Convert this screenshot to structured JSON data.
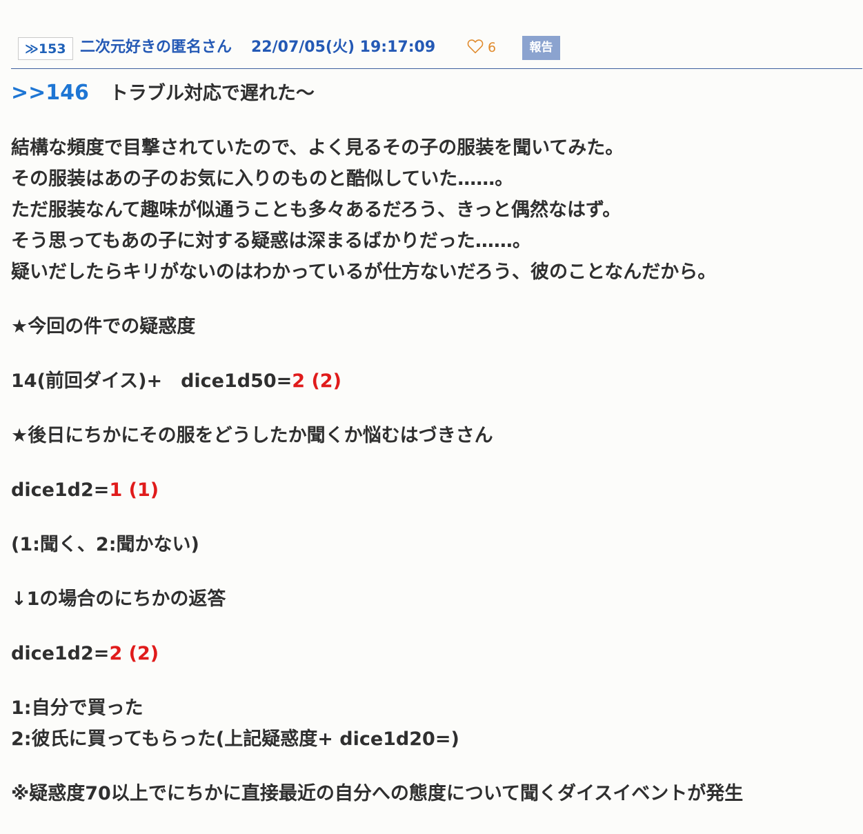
{
  "header": {
    "res_number": "≫153",
    "author": "二次元好きの匿名さん",
    "timestamp": "22/07/05(火) 19:17:09",
    "like_count": "6",
    "report_label": "報告",
    "colors": {
      "author": "#2459b5",
      "like": "#e08a2c",
      "report_bg": "#8ba3cf",
      "divider": "#3d5e9e"
    }
  },
  "body": {
    "anchor": ">>146",
    "anchor_text": "トラブル対応で遅れた〜",
    "para1": [
      "結構な頻度で目撃されていたので、よく見るその子の服装を聞いてみた。",
      "その服装はあの子のお気に入りのものと酷似していた……。",
      "ただ服装なんて趣味が似通うことも多々あるだろう、きっと偶然なはず。",
      "そう思ってもあの子に対する疑惑は深まるばかりだった……。",
      "疑いだしたらキリがないのはわかっているが仕方ないだろう、彼のことなんだから。"
    ],
    "section1_title": "★今回の件での疑惑度",
    "dice1_prefix": "14(前回ダイス)+　dice1d50=",
    "dice1_result": "2 (2)",
    "section2_title": "★後日にちかにその服をどうしたか聞くか悩むはづきさん",
    "dice2_prefix": "dice1d2=",
    "dice2_result": "1 (1)",
    "options1": "(1:聞く、2:聞かない)",
    "section3_title": "↓1の場合のにちかの返答",
    "dice3_prefix": "dice1d2=",
    "dice3_result": "2 (2)",
    "options2": [
      "1:自分で買った",
      "2:彼氏に買ってもらった(上記疑惑度+ dice1d20=)"
    ],
    "note": "※疑惑度70以上でにちかに直接最近の自分への態度について聞くダイスイベントが発生",
    "colors": {
      "text": "#2f2f2f",
      "anchor": "#1e76d4",
      "dice_result": "#e01b1b"
    }
  }
}
